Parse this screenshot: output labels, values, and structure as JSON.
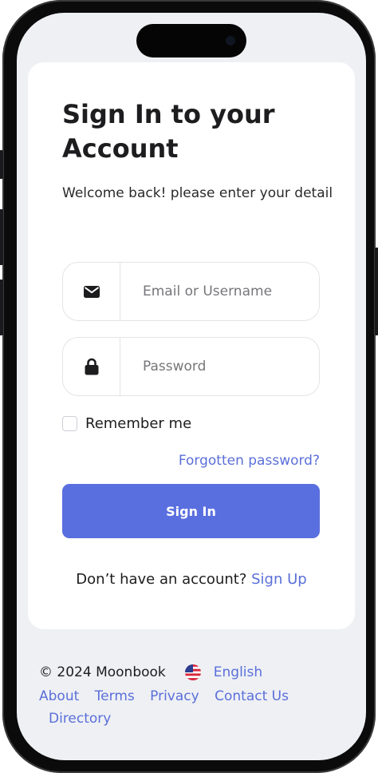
{
  "login": {
    "title": "Sign In to your Account",
    "subtitle": "Welcome back! please enter your detail",
    "email_placeholder": "Email or Username",
    "password_placeholder": "Password",
    "remember_label": "Remember me",
    "forgot_label": "Forgotten password?",
    "signin_label": "Sign In",
    "no_account_text": "Don’t have an account?",
    "signup_label": "Sign Up",
    "icons": {
      "email": "envelope-icon",
      "password": "lock-icon"
    }
  },
  "footer": {
    "copyright": "© 2024 Moonbook",
    "language": "English",
    "language_flag": "us-flag-icon",
    "links": [
      "About",
      "Terms",
      "Privacy",
      "Contact Us",
      "Directory"
    ]
  },
  "colors": {
    "accent": "#5a6fdf",
    "link": "#5b6fd9",
    "screen_bg": "#eef0f4",
    "card_bg": "#ffffff"
  }
}
